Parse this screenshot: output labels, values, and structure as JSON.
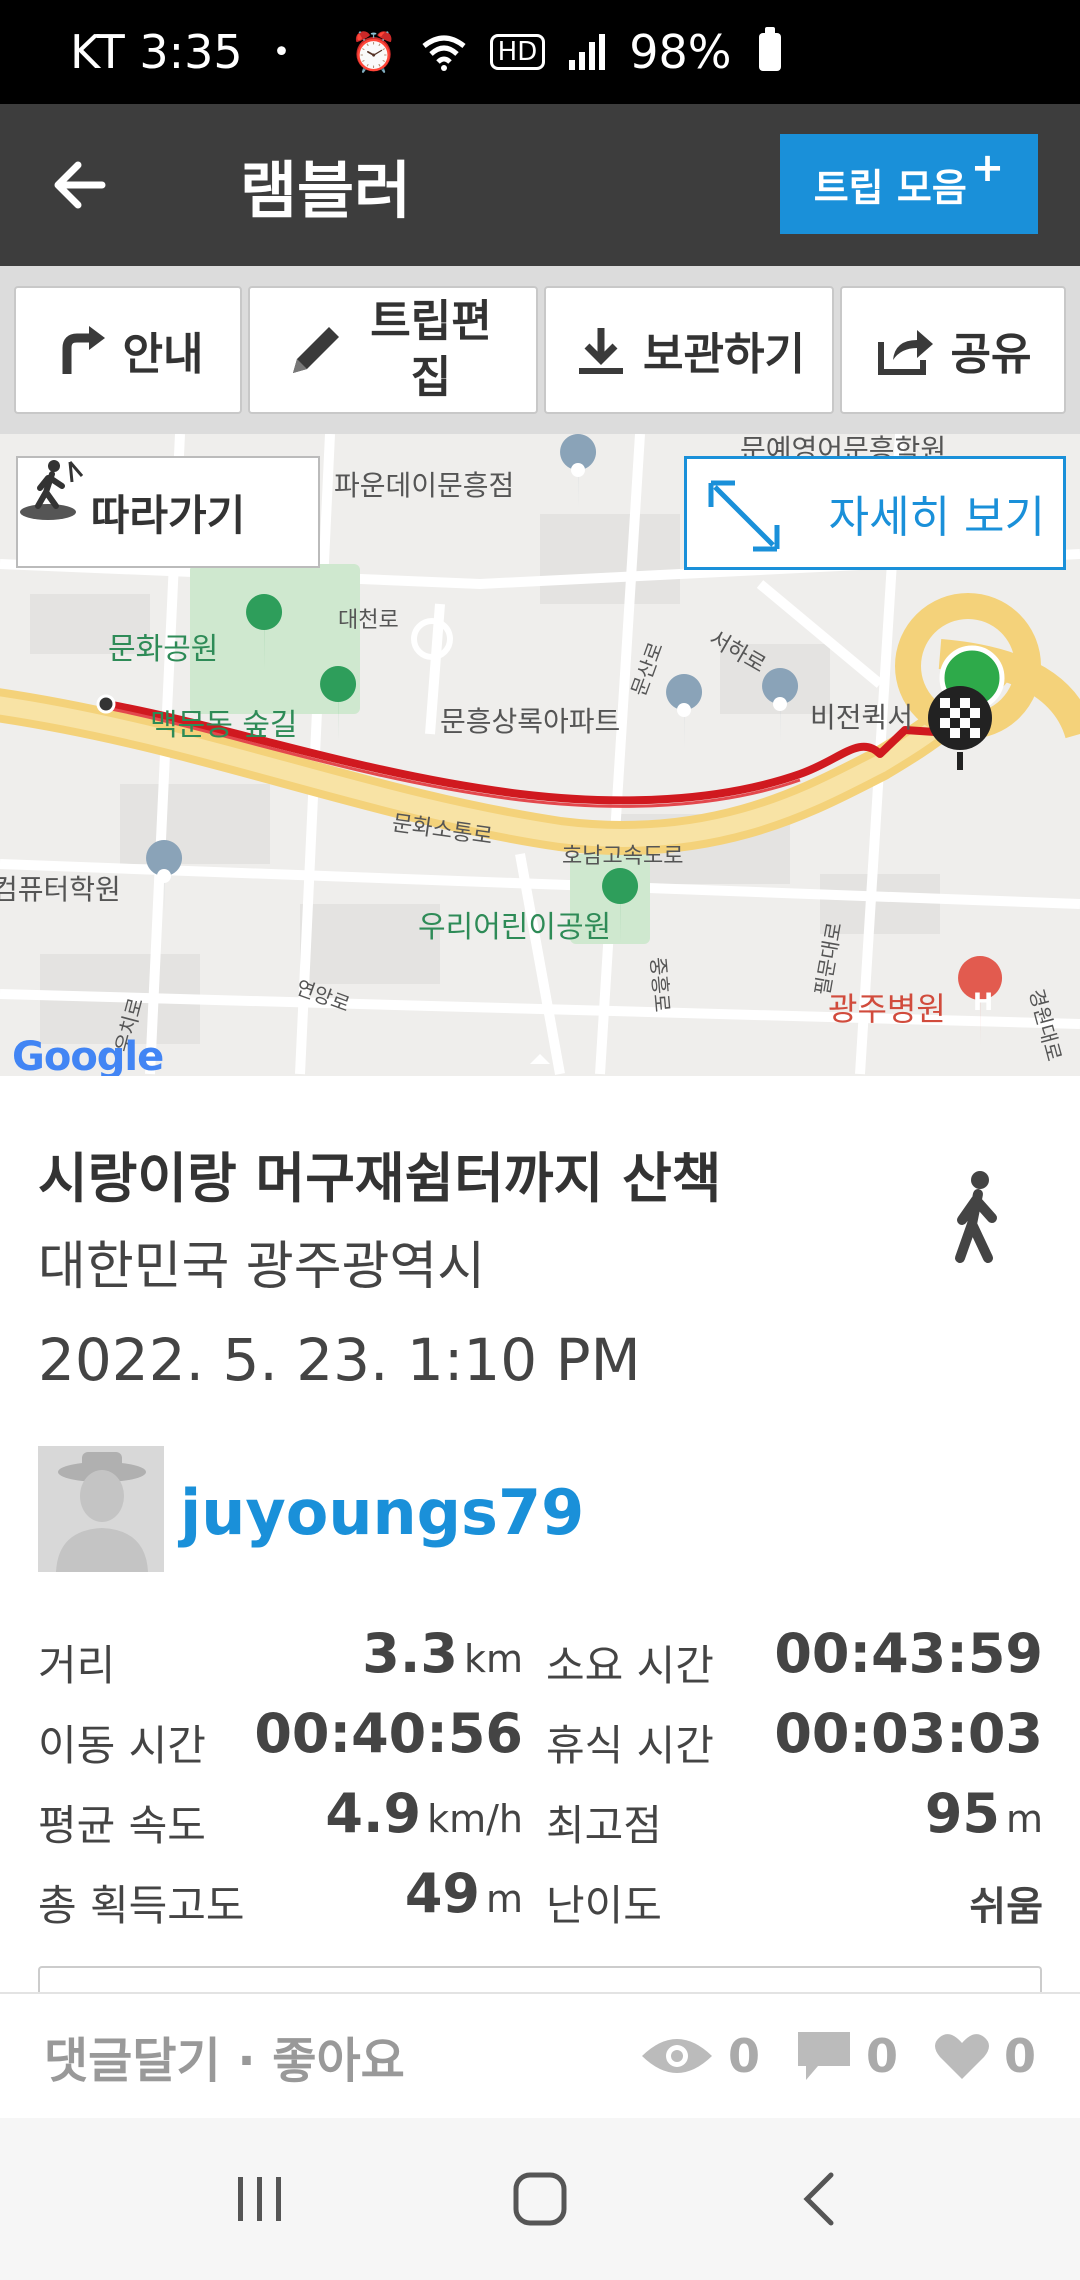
{
  "status_bar": {
    "carrier_time": "KT 3:35",
    "dot": "•",
    "hd": "HD",
    "battery": "98%"
  },
  "app_bar": {
    "title": "램블러",
    "trip_button": "트립 모음",
    "trip_button_plus": "+"
  },
  "toolbar": {
    "guide": "안내",
    "edit": "트립편집",
    "save": "보관하기",
    "share": "공유"
  },
  "map": {
    "follow_button": "따라가기",
    "detail_button": "자세히 보기",
    "labels": {
      "top_partial": "문예영어문흥학원",
      "paun": "파운데이문흥점",
      "munhwa_park": "문화공원",
      "daecheon_ro": "대천로",
      "seohaero": "서하로",
      "munsanro": "문산로",
      "maekmundong": "맥문동 숲길",
      "munheung_apt": "문흥상록아파트",
      "vision": "비전퀵서",
      "munhwa_sodung": "문화소통로",
      "honam": "호남고속도로",
      "computer": "컴퓨터학원",
      "woori": "우리어린이공원",
      "yeonang": "연앙로",
      "ujiro": "우치로",
      "gwangju_hospital": "광주병원",
      "rd_right": "경원대로",
      "rd_vertical": "중흥로",
      "rd_small": "필문대로",
      "google": "Google"
    }
  },
  "trip": {
    "title": "시랑이랑 머구재쉼터까지 산책",
    "location": "대한민국 광주광역시",
    "date": "2022. 5. 23. 1:10 PM",
    "username": "juyoungs79"
  },
  "stats": [
    {
      "label_left": "거리",
      "value_left": "3.3",
      "unit_left": "km",
      "label_right": "소요 시간",
      "value_right": "00:43:59",
      "unit_right": ""
    },
    {
      "label_left": "이동 시간",
      "value_left": "00:40:56",
      "unit_left": "",
      "label_right": "휴식 시간",
      "value_right": "00:03:03",
      "unit_right": ""
    },
    {
      "label_left": "평균 속도",
      "value_left": "4.9",
      "unit_left": "km/h",
      "label_right": "최고점",
      "value_right": "95",
      "unit_right": "m"
    },
    {
      "label_left": "총 획득고도",
      "value_left": "49",
      "unit_left": "m",
      "label_right": "난이도",
      "value_right": "쉬움",
      "unit_right": ""
    }
  ],
  "actions": {
    "comment_like": "댓글달기 · 좋아요",
    "views": "0",
    "comments": "0",
    "likes": "0"
  },
  "colors": {
    "accent": "#1a90d9",
    "route": "#d0191f",
    "app_bar": "#3d3d3d"
  }
}
